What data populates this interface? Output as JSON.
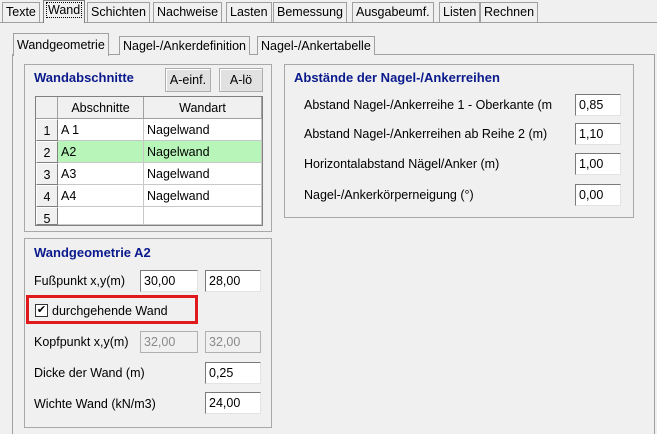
{
  "main_tabs": [
    "Texte",
    "Wand",
    "Schichten",
    "Nachweise",
    "Lasten",
    "Bemessung",
    "Ausgabeumf.",
    "Listen",
    "Rechnen"
  ],
  "sub_tabs": [
    "Wandgeometrie",
    "Nagel-/Ankerdefinition",
    "Nagel-/Ankertabelle"
  ],
  "wandabschnitte": {
    "title": "Wandabschnitte",
    "btn_insert": "A-einf.",
    "btn_delete": "A-lö",
    "col_abschnitte": "Abschnitte",
    "col_wandart": "Wandart",
    "rows": [
      {
        "num": "1",
        "abschnitt": "A 1",
        "wandart": "Nagelwand"
      },
      {
        "num": "2",
        "abschnitt": "A2",
        "wandart": "Nagelwand"
      },
      {
        "num": "3",
        "abschnitt": "A3",
        "wandart": "Nagelwand"
      },
      {
        "num": "4",
        "abschnitt": "A4",
        "wandart": "Nagelwand"
      },
      {
        "num": "5",
        "abschnitt": "",
        "wandart": ""
      }
    ]
  },
  "abstaende": {
    "title": "Abstände der Nagel-/Ankerreihen",
    "fields": [
      {
        "label": "Abstand Nagel-/Ankerreihe 1 - Oberkante (m",
        "value": "0,85"
      },
      {
        "label": "Abstand Nagel-/Ankerreihen ab Reihe 2 (m)",
        "value": "1,10"
      },
      {
        "label": "Horizontalabstand Nägel/Anker (m)",
        "value": "1,00"
      },
      {
        "label": "Nagel-/Ankerkörperneigung (°)",
        "value": "0,00"
      }
    ]
  },
  "geometrie": {
    "title": "Wandgeometrie A2",
    "fusspunkt_label": "Fußpunkt x,y(m)",
    "fusspunkt_x": "30,00",
    "fusspunkt_y": "28,00",
    "checkbox_label": "durchgehende Wand",
    "checkbox_checked": "✔",
    "kopfpunkt_label": "Kopfpunkt x,y(m)",
    "kopfpunkt_x": "32,00",
    "kopfpunkt_y": "32,00",
    "dicke_label": "Dicke der Wand (m)",
    "dicke_value": "0,25",
    "wichte_label": "Wichte  Wand (kN/m3)",
    "wichte_value": "24,00"
  }
}
